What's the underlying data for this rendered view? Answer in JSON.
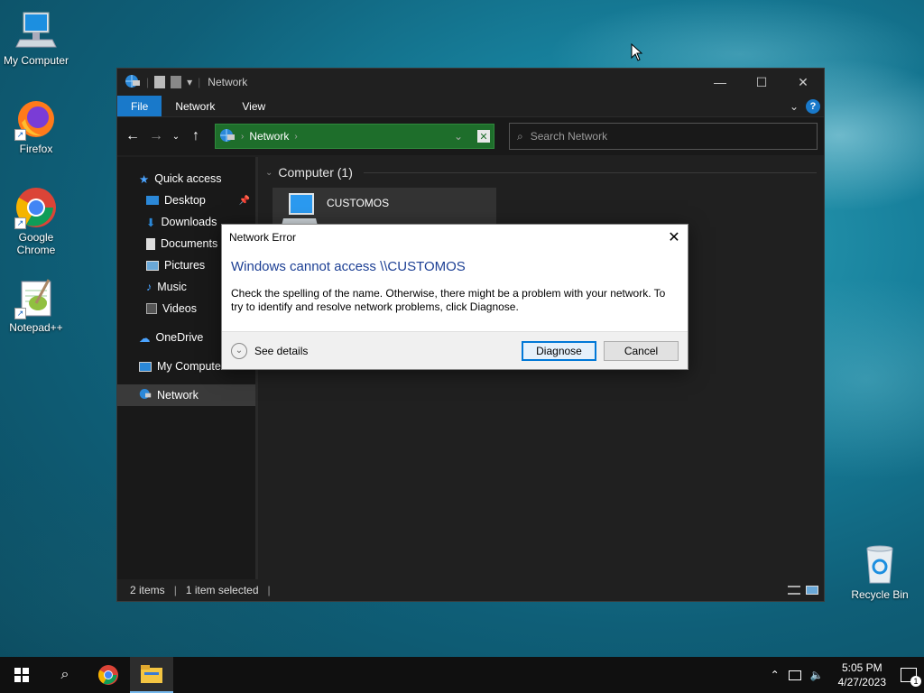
{
  "desktop": {
    "icons": [
      {
        "label": "My Computer"
      },
      {
        "label": "Firefox"
      },
      {
        "label": "Google Chrome"
      },
      {
        "label": "Notepad++"
      },
      {
        "label": "Recycle Bin"
      }
    ]
  },
  "explorer": {
    "title": "Network",
    "ribbon_tabs": [
      "File",
      "Network",
      "View"
    ],
    "address": {
      "crumb": "Network"
    },
    "search": {
      "placeholder": "Search Network"
    },
    "nav": {
      "quick_access": "Quick access",
      "items": [
        "Desktop",
        "Downloads",
        "Documents",
        "Pictures",
        "Music",
        "Videos"
      ],
      "onedrive": "OneDrive",
      "my_computer": "My Computer",
      "network": "Network"
    },
    "group_header": "Computer (1)",
    "computer_name": "CUSTOMOS",
    "status": {
      "items": "2 items",
      "selected": "1 item selected"
    }
  },
  "dialog": {
    "title": "Network Error",
    "main_instruction": "Windows cannot access \\\\CUSTOMOS",
    "message": "Check the spelling of the name. Otherwise, there might be a problem with your network. To try to identify and resolve network problems, click Diagnose.",
    "details_label": "See details",
    "diagnose_label": "Diagnose",
    "cancel_label": "Cancel"
  },
  "taskbar": {
    "time": "5:05 PM",
    "date": "4/27/2023",
    "notification_count": "1"
  },
  "colors": {
    "accent": "#1979ca",
    "address_bar": "#1e6e2b",
    "dialog_title_text": "#1c3f94"
  }
}
